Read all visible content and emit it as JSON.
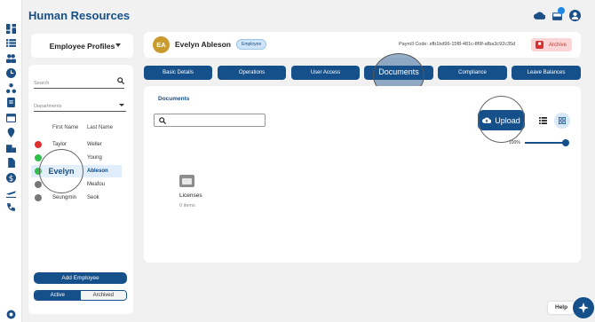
{
  "app": {
    "title": "Human Resources"
  },
  "profile_selector": {
    "label": "Employee Profiles"
  },
  "filters": {
    "search_placeholder": "Search",
    "departments_placeholder": "Departments"
  },
  "employee_list": {
    "columns": [
      "First Name",
      "Last Name"
    ],
    "rows": [
      {
        "first": "Taylor",
        "last": "Weller",
        "status_color": "#e03131"
      },
      {
        "first": "",
        "last": "Young",
        "status_color": "#2fbf4a"
      },
      {
        "first": "",
        "last": "Ableson",
        "status_color": "#2fbf4a",
        "selected": true
      },
      {
        "first": "",
        "last": "Meafou",
        "status_color": "#777777"
      },
      {
        "first": "Seungmin",
        "last": "Seok",
        "status_color": "#777777"
      }
    ],
    "magnified_name": "Evelyn"
  },
  "add_employee_label": "Add Employee",
  "status_toggle": {
    "active_label": "Active",
    "archived_label": "Archived"
  },
  "employee": {
    "initials": "EA",
    "name": "Evelyn Ableson",
    "role_badge": "Employee",
    "payroll_label": "Payroll Code:",
    "payroll_code": "efb1bd96-15f8-481c-8f9f-afba3c92c35d",
    "archive_label": "Archive"
  },
  "tabs": [
    {
      "label": "Basic Details"
    },
    {
      "label": "Operations"
    },
    {
      "label": "User Access"
    },
    {
      "label": "Documents",
      "active": true
    },
    {
      "label": "Compliance"
    },
    {
      "label": "Leave Balances"
    }
  ],
  "documents": {
    "breadcrumb": "Documents",
    "upload_label": "Upload",
    "zoom_label": "100%",
    "zoom_level": 1.0,
    "folders": [
      {
        "name": "Licenses",
        "count_label": "0 items"
      }
    ]
  },
  "help_label": "Help",
  "colors": {
    "primary": "#16508a",
    "accent": "#1e88e5",
    "danger": "#d63031"
  },
  "icons": [
    "dashboard-icon",
    "list-icon",
    "people-icon",
    "clock-icon",
    "org-icon",
    "document-icon",
    "calendar-icon",
    "location-icon",
    "building-icon",
    "file-icon",
    "dollar-icon",
    "plane-icon",
    "phone-icon",
    "settings-icon",
    "cloud-icon",
    "inbox-icon",
    "user-icon"
  ]
}
